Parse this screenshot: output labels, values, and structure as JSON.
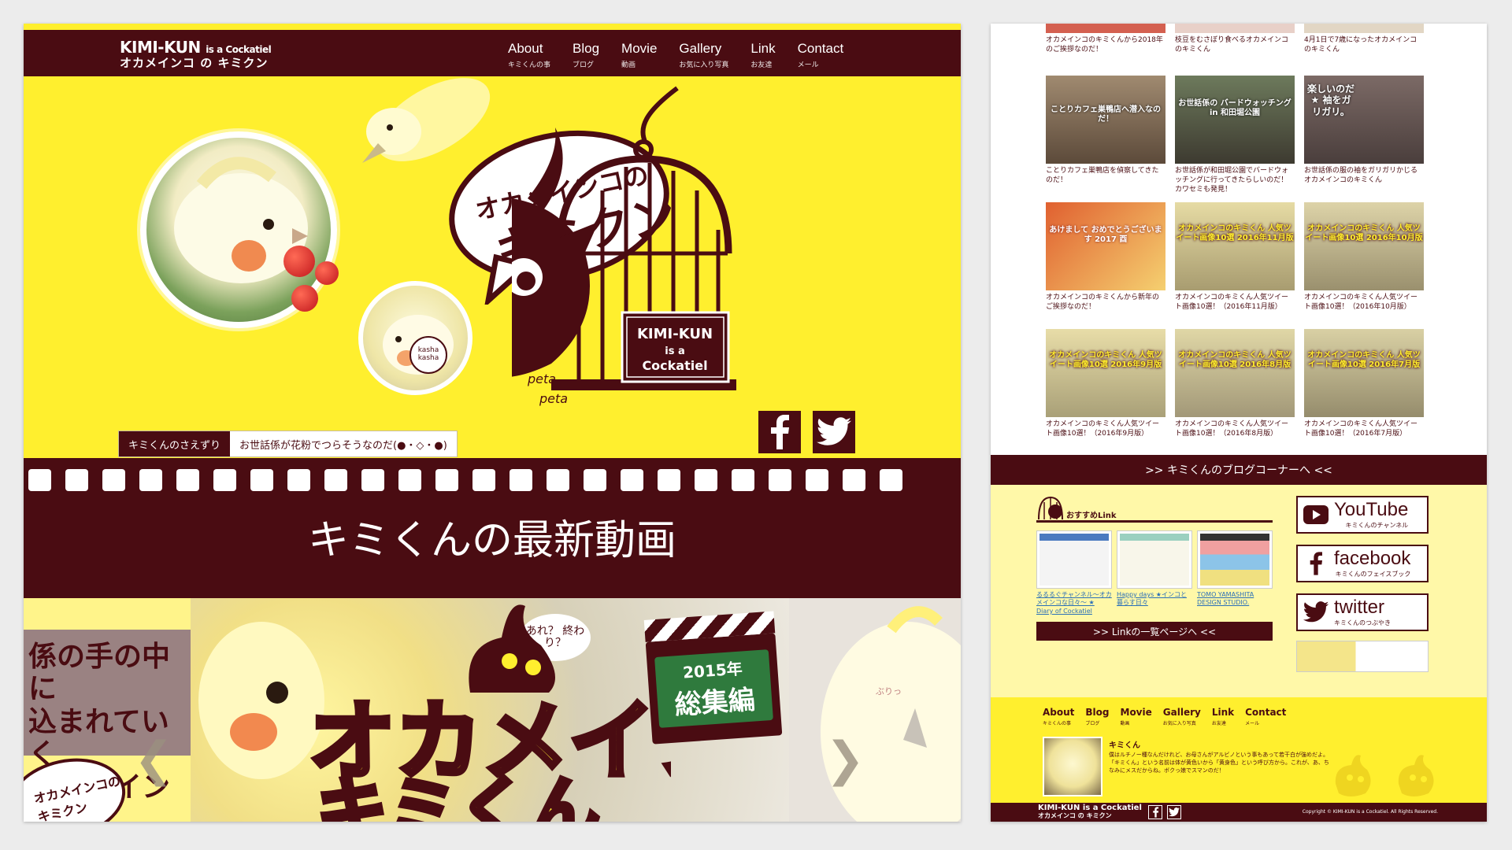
{
  "header": {
    "logo_line1": "KIMI-KUN",
    "logo_line1_small": "is a Cockatiel",
    "logo_line2": "オカメインコ の キミクン"
  },
  "nav": [
    {
      "en": "About",
      "jp": "キミくんの事"
    },
    {
      "en": "Blog",
      "jp": "ブログ"
    },
    {
      "en": "Movie",
      "jp": "動画"
    },
    {
      "en": "Gallery",
      "jp": "お気に入り写真"
    },
    {
      "en": "Link",
      "jp": "お友達"
    },
    {
      "en": "Contact",
      "jp": "メール"
    }
  ],
  "hero": {
    "title_line1": "オカメインコの",
    "title_line2": "キミクン",
    "cage_sign": [
      "KIMI-KUN",
      "is a",
      "Cockatiel"
    ],
    "kasha": "kasha kasha",
    "peta1": "peta",
    "peta2": "peta",
    "shout_label": "キミくんのさえずり",
    "shout_text": "お世話係が花粉でつらそうなのだ(●・◇・●)"
  },
  "film": {
    "title": "キミくんの最新動画"
  },
  "slider": {
    "prev_text": "係の手の中に\n込まれていく\nオカメインコ",
    "prev_logo": "オカメインコの キミクン",
    "bubble": "あれ？ 終わり？",
    "main_big": "オカメインコの",
    "main_kana": "キミくん",
    "clap_year": "2015年",
    "clap_title": "総集編",
    "next_tag": "ぶりっ",
    "arrow_prev": "❮",
    "arrow_next": "❯"
  },
  "blog_top_captions": [
    "オカメインコのキミくんから2018年のご挨拶なのだ！",
    "枝豆をむさぼり食べるオカメインコのキミくん",
    "4月1日で7歳になったオカメインコのキミくん"
  ],
  "blog_grid": [
    {
      "overlay": "ことりカフェ巣鴨店へ潜入なのだ！",
      "caption": "ことりカフェ巣鴨店を偵察してきたのだ！",
      "bg": "#8d7a63"
    },
    {
      "overlay": "お世話係の バードウォッチング in 和田堀公園",
      "caption": "お世話係が和田堀公園でバードウォッチングに行ってきたらしいのだ！カワセミも発見！",
      "bg": "#5b6a4c"
    },
    {
      "overlay": "楽しいのだ★ 袖をガリガリ。",
      "caption": "お世話係の服の袖をガリガリかじるオカメインコのキミくん",
      "bg": "#6b5a57"
    },
    {
      "overlay": "あけまして おめでとうございます 2017 酉",
      "caption": "オカメインコのキミくんから新年のご挨拶なのだ！",
      "bg": "#d8532d"
    },
    {
      "overlay": "オカメインコのキミくん 人気ツイート画像10選 2016年11月版",
      "caption": "オカメインコのキミくん人気ツイート画像10選！（2016年11月版）",
      "bg": "#cbc08a"
    },
    {
      "overlay": "オカメインコのキミくん 人気ツイート画像10選 2016年10月版",
      "caption": "オカメインコのキミくん人気ツイート画像10選！（2016年10月版）",
      "bg": "#bdb48a"
    },
    {
      "overlay": "オカメインコのキミくん 人気ツイート画像10選 2016年9月版",
      "caption": "オカメインコのキミくん人気ツイート画像10選！（2016年9月版）",
      "bg": "#c8bd88"
    },
    {
      "overlay": "オカメインコのキミくん 人気ツイート画像10選 2016年8月版",
      "caption": "オカメインコのキミくん人気ツイート画像10選！（2016年8月版）",
      "bg": "#c2b98e"
    },
    {
      "overlay": "オカメインコのキミくん 人気ツイート画像10選 2016年7月版",
      "caption": "オカメインコのキミくん人気ツイート画像10選！（2016年7月版）",
      "bg": "#b8ae8a"
    }
  ],
  "blog_corner": ">> キミくんのブログコーナーへ <<",
  "recommend": {
    "heading": "おすすめLink",
    "items": [
      {
        "caption": "るるるぐチャンネル～オカメインコな日々～ ★ Diary of Cockatiel"
      },
      {
        "caption": "Happy days ★インコと暮らす日々"
      },
      {
        "caption": "TOMO YAMASHITA DESIGN STUDIO."
      }
    ],
    "more": ">> Linkの一覧ページへ <<"
  },
  "sns": [
    {
      "name": "YouTube",
      "sub": "キミくんのチャンネル"
    },
    {
      "name": "facebook",
      "sub": "キミくんのフェイスブック"
    },
    {
      "name": "twitter",
      "sub": "キミくんのつぶやき"
    }
  ],
  "footer": {
    "nav": [
      {
        "en": "About",
        "jp": "キミくんの事"
      },
      {
        "en": "Blog",
        "jp": "ブログ"
      },
      {
        "en": "Movie",
        "jp": "動画"
      },
      {
        "en": "Gallery",
        "jp": "お気に入り写真"
      },
      {
        "en": "Link",
        "jp": "お友達"
      },
      {
        "en": "Contact",
        "jp": "メール"
      }
    ],
    "profile_name": "キミくん",
    "profile_text": "僕はルチノー種なんだけれど、お母さんがアルビノという事もあって若干白が強めだよ。「キミくん」という名前は体が黄色いから「黄身色」という呼び方から。これが、あ、ちなみにメスだからね。ボクっ娘でスマンのだ！",
    "logo_a": "KIMI-KUN is a Cockatiel",
    "logo_b": "オカメインコ の キミクン",
    "copyright": "Copyright © KIMI-KUN is a Cockatiel. All Rights Reserved."
  },
  "colors": {
    "brand_dark": "#4a0c12",
    "brand_yellow": "#ffef2e",
    "pale_yellow": "#fff8a8"
  }
}
